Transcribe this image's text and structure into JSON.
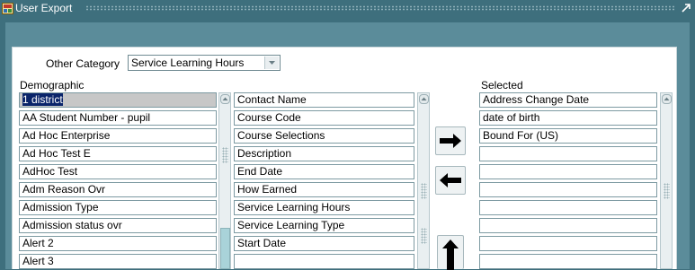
{
  "window": {
    "title": "User Export"
  },
  "category": {
    "label": "Other Category",
    "value": "Service Learning Hours"
  },
  "demographic": {
    "header": "Demographic",
    "items": [
      "1 district",
      "AA Student Number - pupil",
      "Ad Hoc Enterprise",
      "Ad Hoc Test E",
      "AdHoc Test",
      "Adm Reason Ovr",
      "Admission Type",
      "Admission status ovr",
      "Alert 2",
      "Alert 3"
    ]
  },
  "category_fields": {
    "items": [
      "Contact Name",
      "Course Code",
      "Course Selections",
      "Description",
      "End Date",
      "How Earned",
      "Service Learning Hours",
      "Service Learning Type",
      "Start Date",
      ""
    ]
  },
  "selected": {
    "header": "Selected",
    "items": [
      "Address Change Date",
      "date of birth",
      "Bound For (US)",
      "",
      "",
      "",
      "",
      "",
      "",
      ""
    ]
  },
  "buttons": {
    "add": "right-arrow-icon",
    "remove": "left-arrow-icon",
    "move_up": "up-arrow-icon"
  },
  "colors": {
    "window_bg": "#3e6f7d",
    "canvas": "#5b8c9a",
    "highlight": "#0a246a",
    "selected_row": "#c7c7c7",
    "scroll_thumb": "#a9d3d9"
  }
}
